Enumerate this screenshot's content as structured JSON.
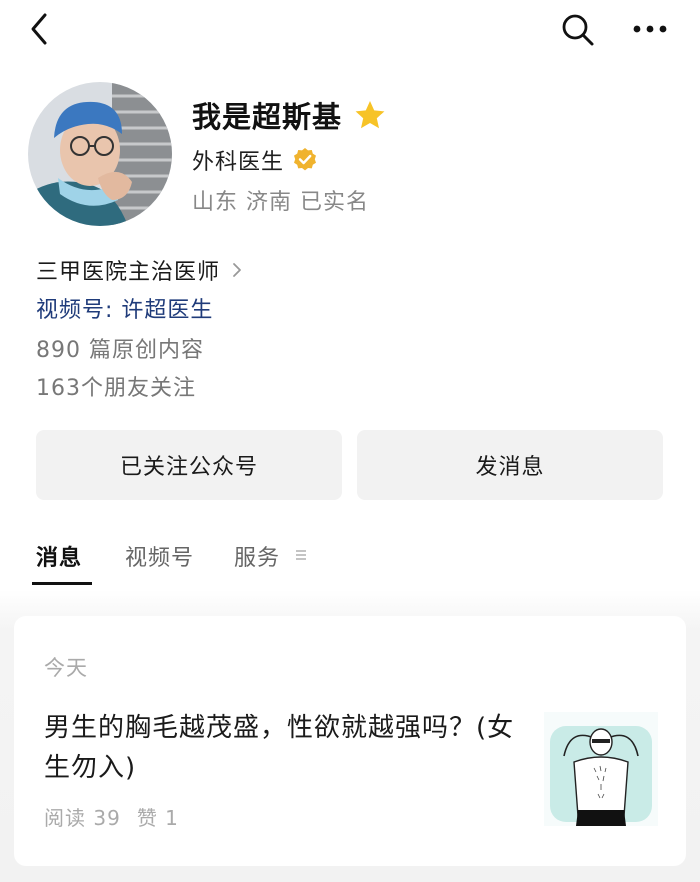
{
  "profile": {
    "name": "我是超斯基",
    "role": "外科医生",
    "location": "山东 济南 已实名"
  },
  "info": {
    "hospital": "三甲医院主治医师",
    "channel": "视频号: 许超医生",
    "articles": "890 篇原创内容",
    "friends": "163个朋友关注"
  },
  "actions": {
    "follow_label": "已关注公众号",
    "message_label": "发消息"
  },
  "tabs": [
    {
      "label": "消息",
      "active": true
    },
    {
      "label": "视频号",
      "active": false
    },
    {
      "label": "服务",
      "active": false
    }
  ],
  "feed": {
    "date": "今天",
    "article": {
      "title": "男生的胸毛越茂盛，性欲就越强吗？(女生勿入)",
      "reads": "阅读 39",
      "likes": "赞 1"
    }
  },
  "icons": {
    "back": "chevron-left-icon",
    "search": "search-icon",
    "more": "more-icon",
    "star": "star-icon",
    "verified": "verified-badge-icon",
    "menu": "menu-lines-icon"
  },
  "colors": {
    "star": "#F7C327",
    "verified": "#F0B32E",
    "link": "#1F3B7A",
    "button_bg": "#F2F2F2"
  }
}
